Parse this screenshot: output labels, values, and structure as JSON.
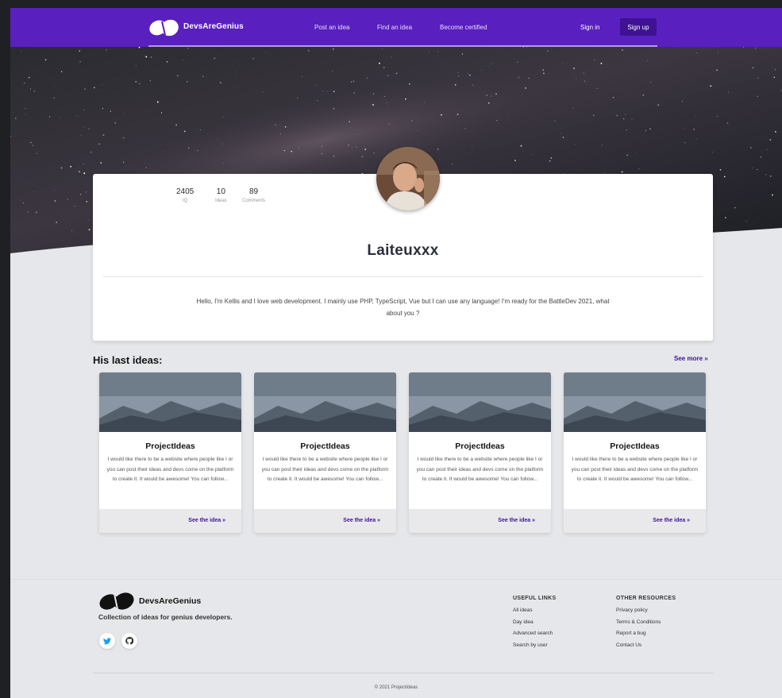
{
  "brand": {
    "name": "DevsAreGenius",
    "tagline": "Collection of ideas for genius developers."
  },
  "nav": {
    "links": [
      "Post an idea",
      "Find an idea",
      "Become certified"
    ],
    "signin": "Sign in",
    "signup": "Sign up"
  },
  "profile": {
    "stats": [
      {
        "value": "2405",
        "label": "IQ"
      },
      {
        "value": "10",
        "label": "Ideas"
      },
      {
        "value": "89",
        "label": "Comments"
      }
    ],
    "username": "Laiteuxxx",
    "bio": "Hello, I'm Kellis and I love web development. I mainly use PHP, TypeScript, Vue but I can use any language! I'm ready for the BattleDev 2021, what about you ?"
  },
  "ideas": {
    "title": "His last ideas:",
    "see_more": "See more »",
    "cards": [
      {
        "title": "ProjectIdeas",
        "text": "I would like there to be a website where people like I or you can post their ideas and devs come on the platform to create it. It would be awesome! You can follow...",
        "link": "See the idea »"
      },
      {
        "title": "ProjectIdeas",
        "text": "I would like there to be a website where people like I or you can post their ideas and devs come on the platform to create it. It would be awesome! You can follow...",
        "link": "See the idea »"
      },
      {
        "title": "ProjectIdeas",
        "text": "I would like there to be a website where people like I or you can post their ideas and devs come on the platform to create it. It would be awesome! You can follow...",
        "link": "See the idea »"
      },
      {
        "title": "ProjectIdeas",
        "text": "I would like there to be a website where people like I or you can post their ideas and devs come on the platform to create it. It would be awesome! You can follow...",
        "link": "See the idea »"
      }
    ]
  },
  "footer": {
    "social_icons": [
      "twitter-icon",
      "github-icon"
    ],
    "useful_links": {
      "title": "USEFUL LINKS",
      "items": [
        "All ideas",
        "Day idea",
        "Advanced search",
        "Search by user"
      ]
    },
    "other_resources": {
      "title": "OTHER RESOURCES",
      "items": [
        "Privacy policy",
        "Terms & Conditions",
        "Report a bug",
        "Contact Us"
      ]
    },
    "copyright": "© 2021 ProjectIdeas"
  },
  "colors": {
    "primary": "#5a1fbf",
    "primary_dark": "#3e1293",
    "background": "#e6e7ea",
    "twitter": "#1da1f2"
  }
}
